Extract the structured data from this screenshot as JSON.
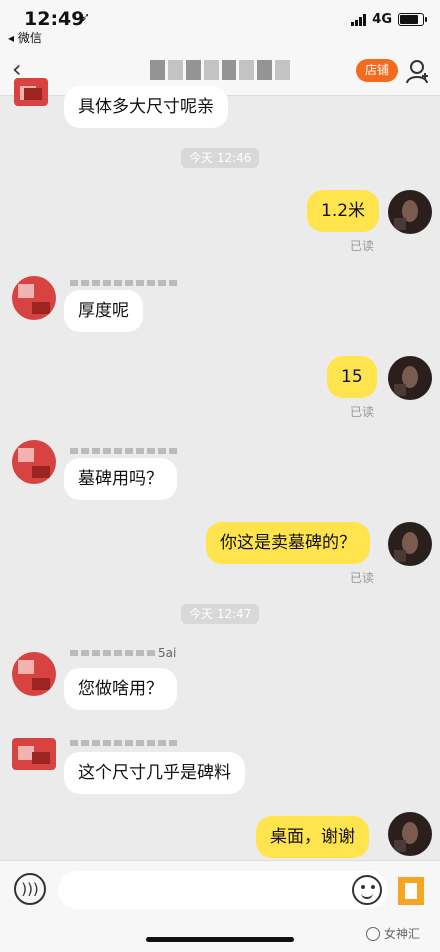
{
  "status_bar": {
    "time": "12:49",
    "location_arrow": "➶",
    "back_app": "◂ 微信",
    "network": "4G"
  },
  "nav": {
    "back_icon": "‹",
    "title_obscured": "",
    "shop_button": "店铺"
  },
  "messages": [
    {
      "side": "left",
      "text": "具体多大尺寸呢亲"
    },
    {
      "type": "time",
      "text": "今天 12:46"
    },
    {
      "side": "right",
      "text": "1.2米",
      "status": "已读"
    },
    {
      "side": "left",
      "text": "厚度呢"
    },
    {
      "side": "right",
      "text": "15",
      "status": "已读"
    },
    {
      "side": "left",
      "text": "墓碑用吗？"
    },
    {
      "side": "right",
      "text": "你这是卖墓碑的？",
      "status": "已读"
    },
    {
      "type": "time",
      "text": "今天 12:47"
    },
    {
      "side": "left",
      "nickname_tail": "5ai",
      "text": "您做啥用？"
    },
    {
      "side": "left",
      "text": "这个尺寸几乎是碑料"
    },
    {
      "side": "right",
      "text": "桌面，谢谢"
    }
  ],
  "input_bar": {
    "placeholder": "",
    "voice_icon": "voice-icon",
    "emoji_icon": "emoji-icon"
  },
  "watermark": {
    "text": "女神汇"
  }
}
